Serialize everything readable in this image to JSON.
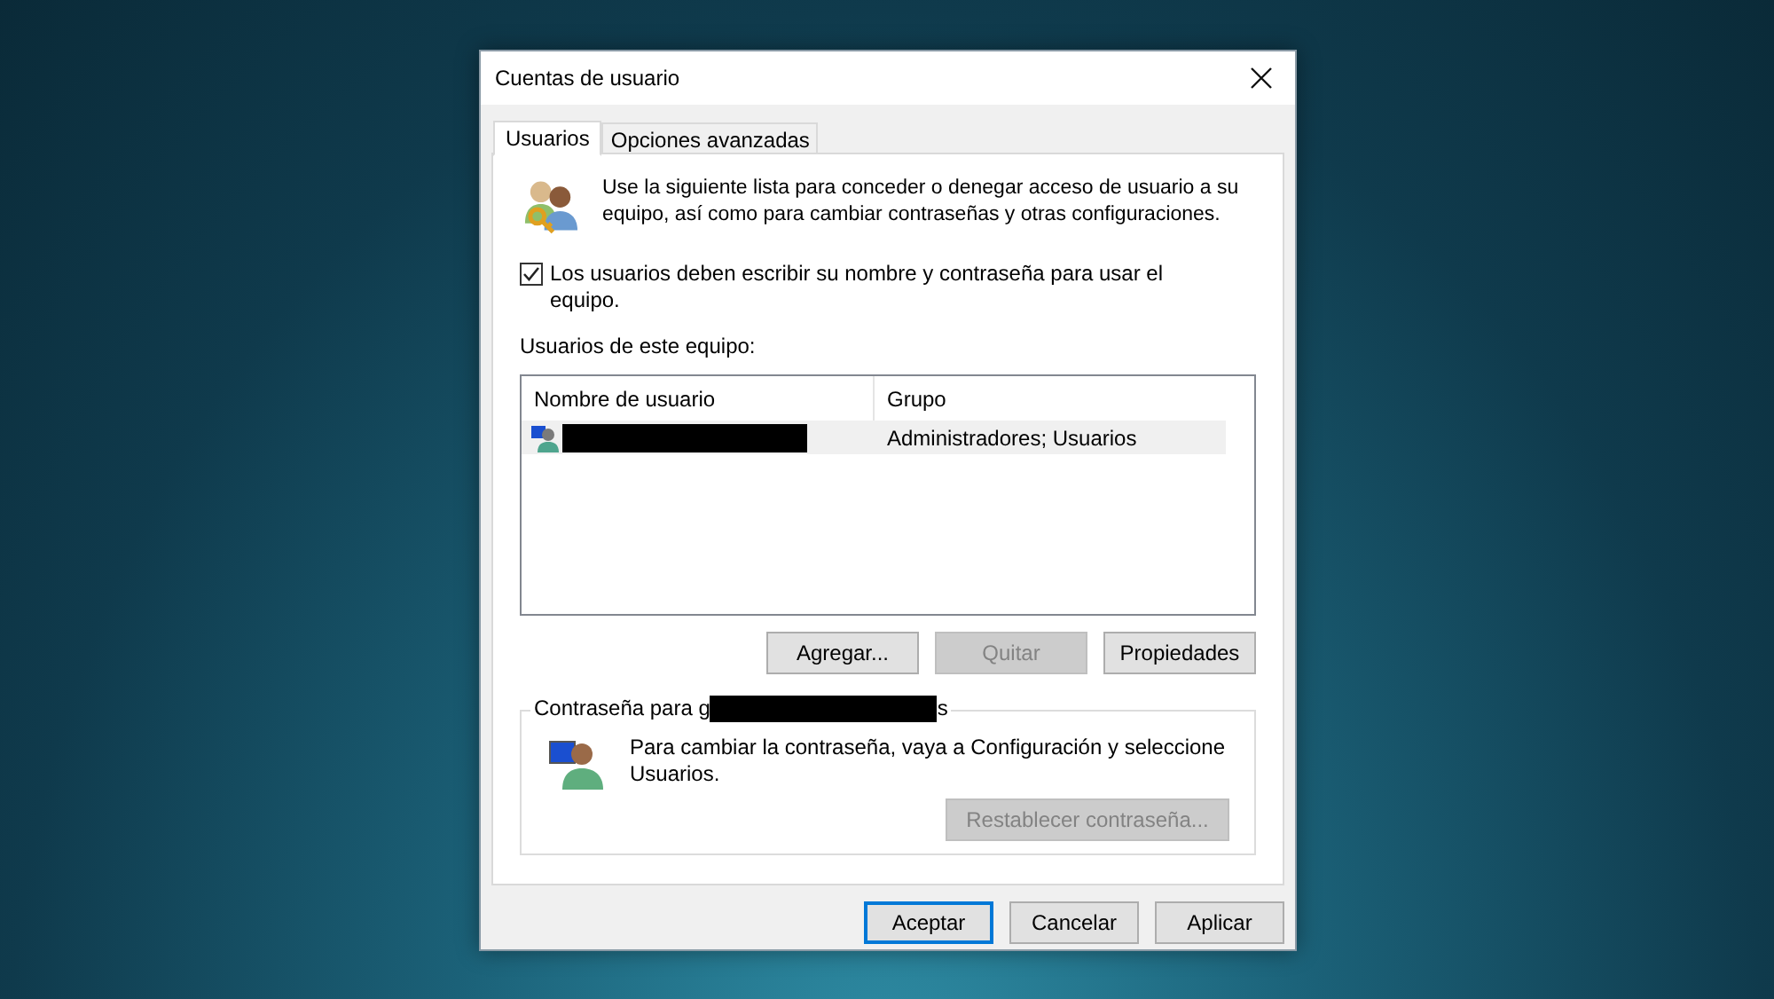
{
  "window": {
    "title": "Cuentas de usuario"
  },
  "tabs": [
    {
      "label": "Usuarios",
      "selected": true
    },
    {
      "label": "Opciones avanzadas",
      "selected": false
    }
  ],
  "intro": "Use la siguiente lista para conceder o denegar acceso de usuario a su equipo, así como para cambiar contraseñas y otras configuraciones.",
  "require_login": {
    "label": "Los usuarios deben escribir su nombre y contraseña para usar el equipo.",
    "checked": true
  },
  "users_label": "Usuarios de este equipo:",
  "users_table": {
    "columns": [
      "Nombre de usuario",
      "Grupo"
    ],
    "rows": [
      {
        "group": "Administradores; Usuarios",
        "selected": true
      }
    ]
  },
  "list_buttons": [
    {
      "label": "Agregar...",
      "disabled": false
    },
    {
      "label": "Quitar",
      "disabled": true
    },
    {
      "label": "Propiedades",
      "disabled": false
    }
  ],
  "password_group": {
    "legend_start": "Contraseña para g",
    "legend_end": "s",
    "message": "Para cambiar la contraseña, vaya a Configuración y seleccione Usuarios.",
    "button": {
      "label": "Restablecer contraseña...",
      "disabled": true
    }
  },
  "dialog_buttons": [
    {
      "label": "Aceptar",
      "default": true
    },
    {
      "label": "Cancelar",
      "default": false
    },
    {
      "label": "Aplicar",
      "default": false
    }
  ]
}
